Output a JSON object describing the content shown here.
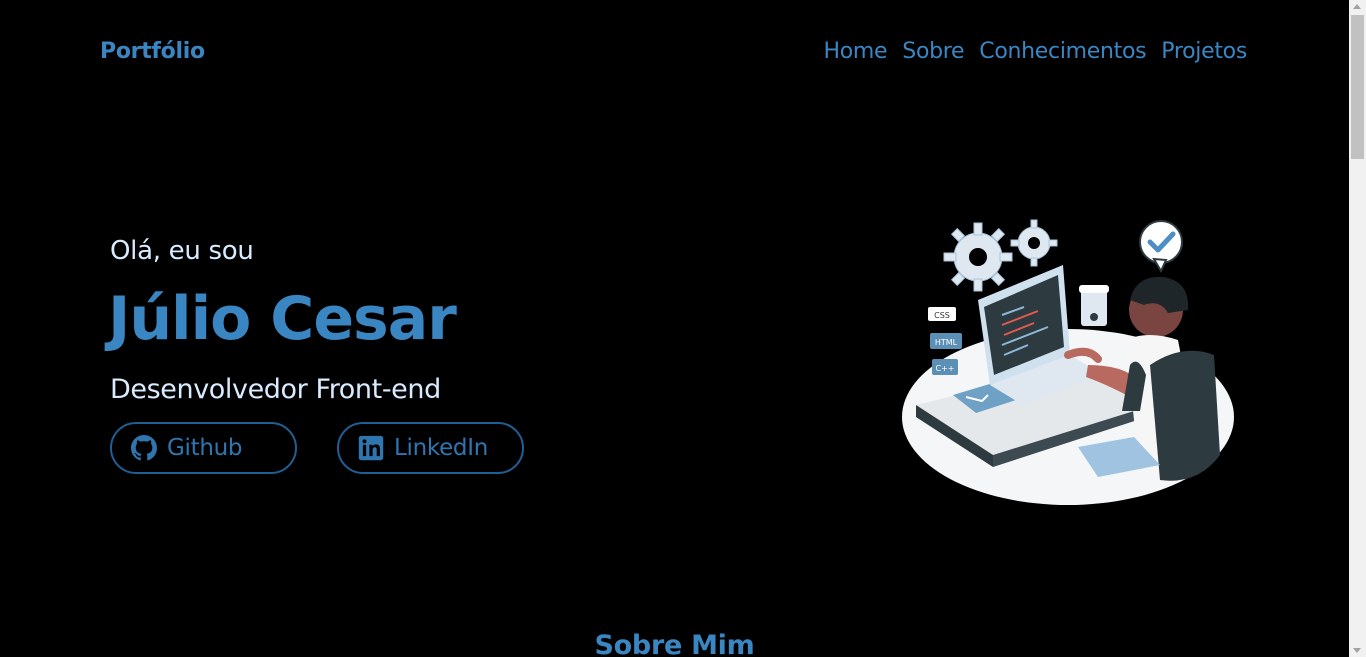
{
  "header": {
    "brand": "Portfólio",
    "nav": [
      {
        "label": "Home"
      },
      {
        "label": "Sobre"
      },
      {
        "label": "Conhecimentos"
      },
      {
        "label": "Projetos"
      }
    ]
  },
  "hero": {
    "greeting": "Olá, eu sou",
    "name": "Júlio Cesar",
    "role": "Desenvolvedor Front-end",
    "buttons": {
      "github": {
        "label": "Github",
        "icon": "github-icon"
      },
      "linkedin": {
        "label": "LinkedIn",
        "icon": "linkedin-icon"
      }
    },
    "illustration": {
      "name": "developer-at-desk-illustration",
      "badges": [
        "CSS",
        "HTML",
        "C++"
      ]
    }
  },
  "sections": {
    "about_title": "Sobre Mim"
  },
  "colors": {
    "background": "#000000",
    "accent": "#3a86c2",
    "text_light": "#d9ecff",
    "button_border": "#1f5f94"
  }
}
